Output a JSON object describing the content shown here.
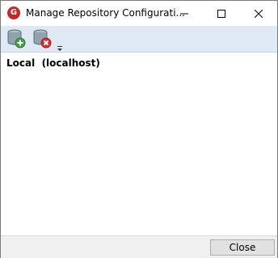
{
  "window": {
    "title": "Manage Repository Configurati..."
  },
  "toolbar": {
    "add_icon": "database-add-icon",
    "remove_icon": "database-remove-icon",
    "more_icon": "overflow-chevron-icon"
  },
  "repositories": {
    "items": [
      {
        "label": "Local  (localhost)"
      }
    ]
  },
  "footer": {
    "close_label": "Close"
  },
  "colors": {
    "app_icon": "#c62828",
    "toolbar_bg": "#dfe9f5",
    "add_badge": "#43a047",
    "remove_badge": "#d32f2f",
    "button_bg": "#e1e1e1"
  }
}
